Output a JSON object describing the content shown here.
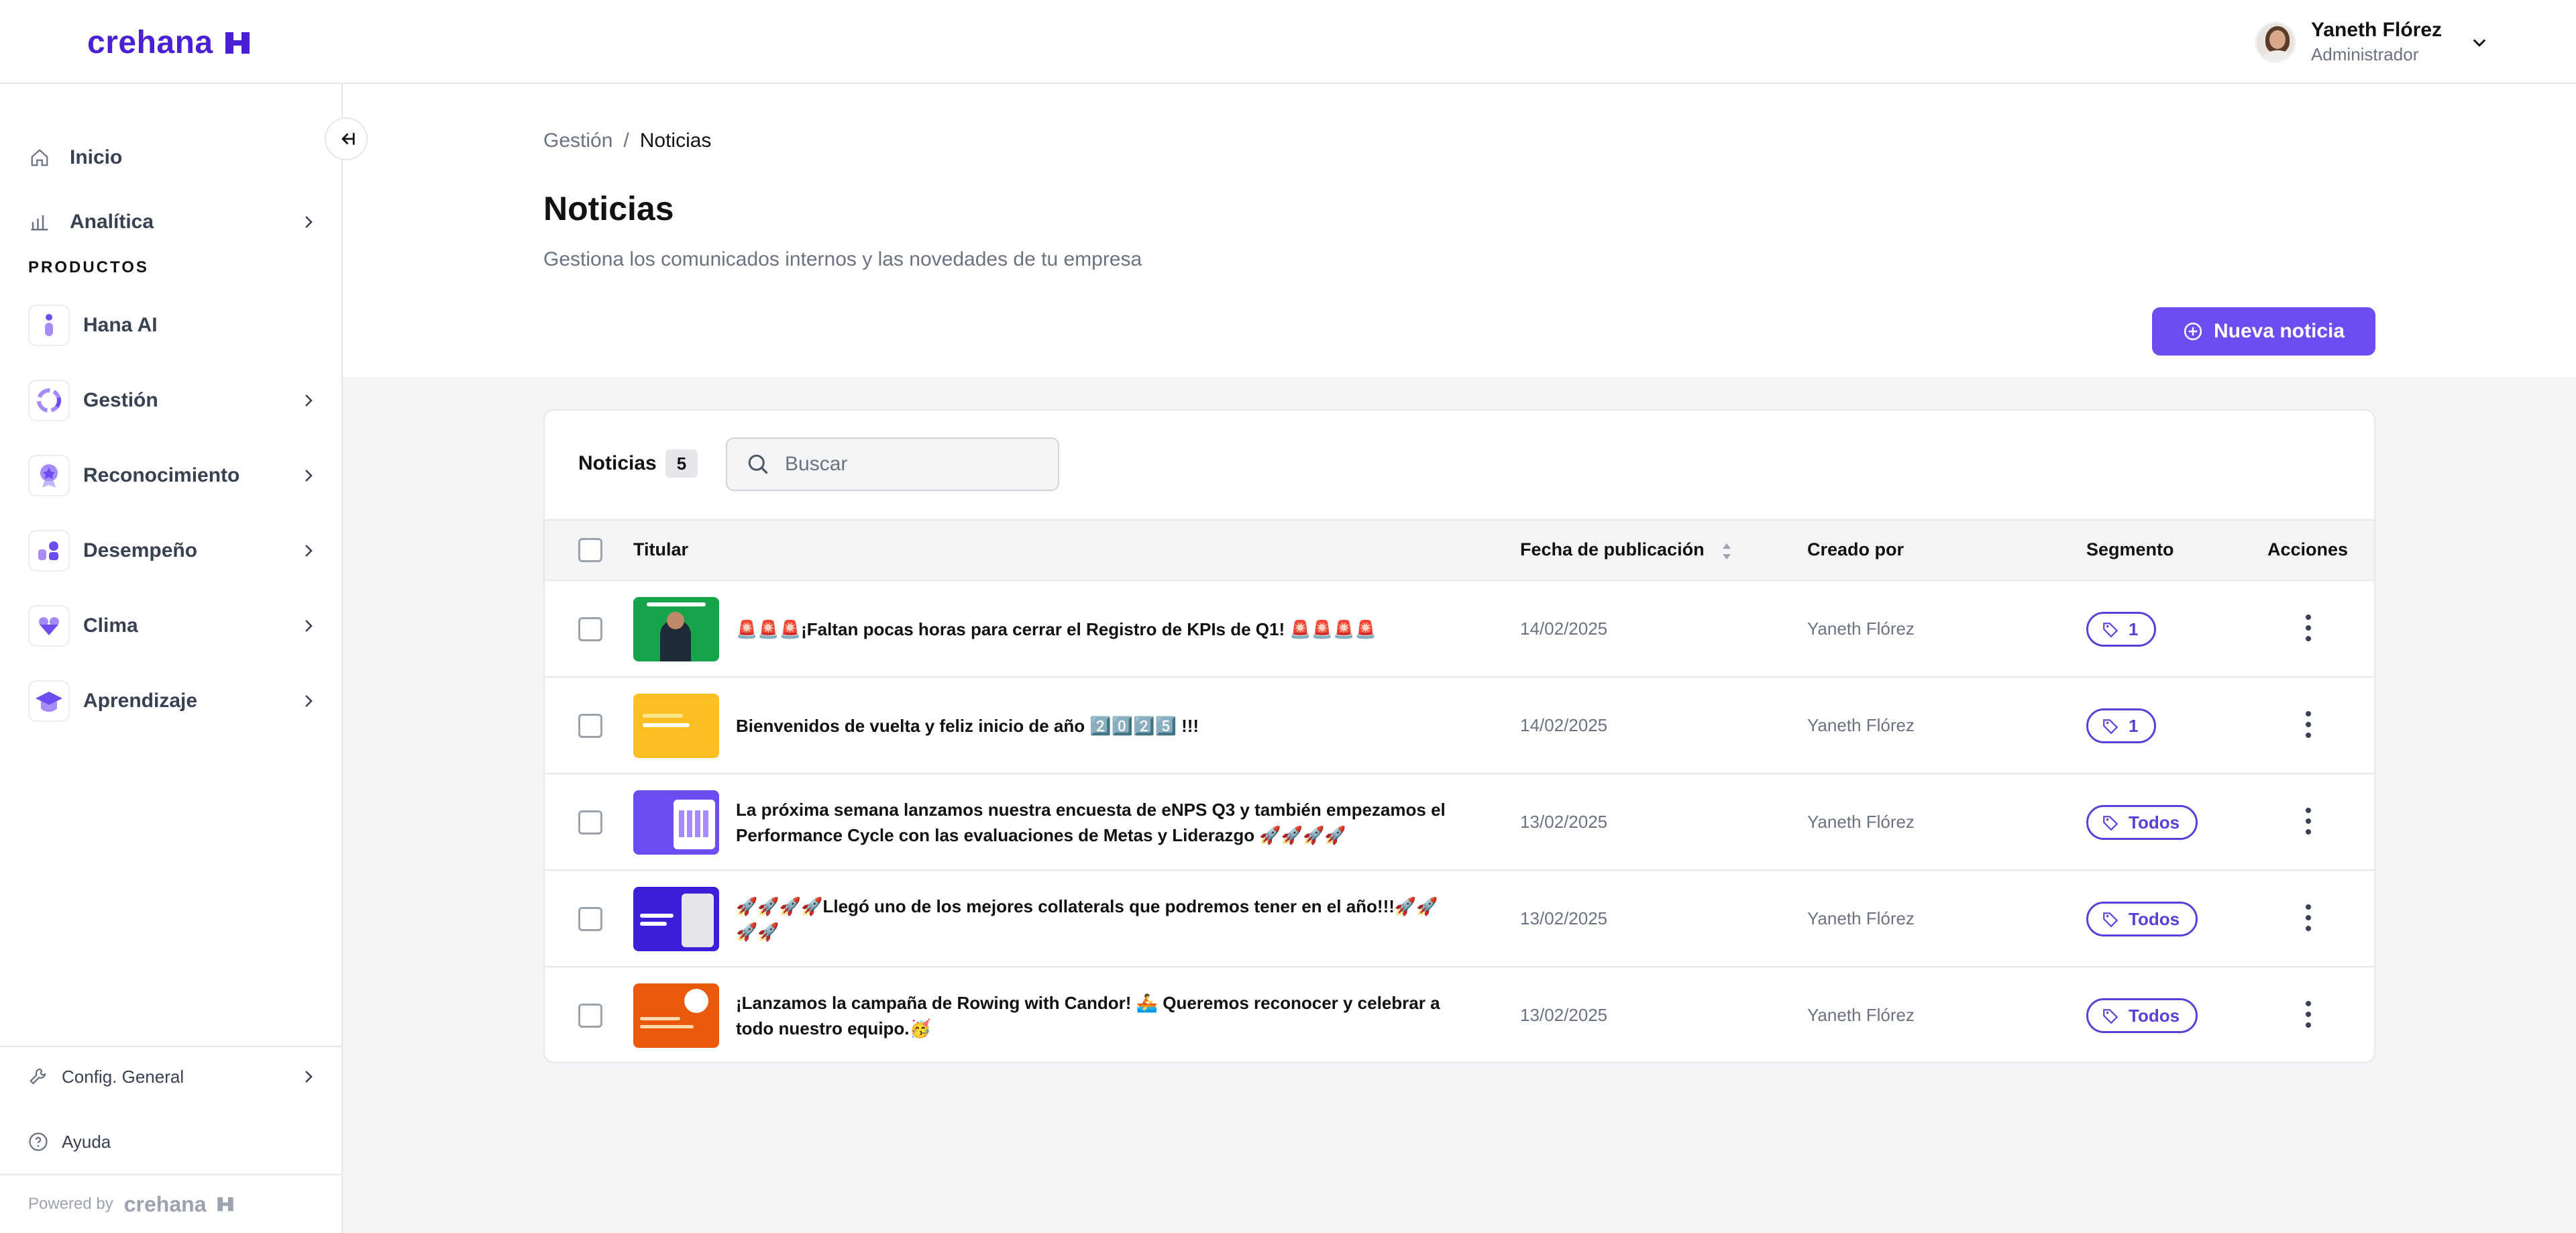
{
  "app": {
    "logo_text": "crehana"
  },
  "user": {
    "name": "Yaneth Flórez",
    "role": "Administrador"
  },
  "sidebar": {
    "top_items": [
      {
        "label": "Inicio",
        "icon": "home-icon"
      },
      {
        "label": "Analítica",
        "icon": "bar-chart-icon"
      }
    ],
    "section_label": "PRODUCTOS",
    "products": [
      {
        "label": "Hana AI",
        "icon": "hana-ai-icon"
      },
      {
        "label": "Gestión",
        "icon": "gestion-icon"
      },
      {
        "label": "Reconocimiento",
        "icon": "reconocimiento-icon"
      },
      {
        "label": "Desempeño",
        "icon": "desempeno-icon"
      },
      {
        "label": "Clima",
        "icon": "clima-icon"
      },
      {
        "label": "Aprendizaje",
        "icon": "aprendizaje-icon"
      }
    ],
    "bottom_items": [
      {
        "label": "Config. General",
        "icon": "wrench-icon"
      },
      {
        "label": "Ayuda",
        "icon": "help-icon"
      }
    ],
    "powered_by_label": "Powered by",
    "powered_by_logo": "crehana"
  },
  "breadcrumb": {
    "parent": "Gestión",
    "separator": "/",
    "current": "Noticias"
  },
  "page": {
    "title": "Noticias",
    "subtitle": "Gestiona los comunicados internos y las novedades de tu empresa",
    "new_button_label": "Nueva noticia"
  },
  "table": {
    "title": "Noticias",
    "count": "5",
    "search_placeholder": "Buscar",
    "columns": {
      "title": "Titular",
      "date": "Fecha de publicación",
      "author": "Creado por",
      "segment": "Segmento",
      "actions": "Acciones"
    },
    "rows": [
      {
        "title": "🚨🚨🚨¡Faltan pocas horas para cerrar el Registro de KPIs de Q1! 🚨🚨🚨🚨",
        "date": "14/02/2025",
        "author": "Yaneth Flórez",
        "segment": "1",
        "thumb_color": "#16a34a"
      },
      {
        "title": "Bienvenidos de vuelta y feliz inicio de año 2️⃣0️⃣2️⃣5️⃣ !!!",
        "date": "14/02/2025",
        "author": "Yaneth Flórez",
        "segment": "1",
        "thumb_color": "#fbbf24"
      },
      {
        "title": "La próxima semana lanzamos nuestra encuesta de eNPS Q3 y también empezamos el Performance Cycle con las evaluaciones de Metas y Liderazgo 🚀🚀🚀🚀",
        "date": "13/02/2025",
        "author": "Yaneth Flórez",
        "segment": "Todos",
        "thumb_color": "#6d4df2"
      },
      {
        "title": "🚀🚀🚀🚀Llegó uno de los mejores collaterals que podremos tener en el año!!!🚀🚀🚀🚀",
        "date": "13/02/2025",
        "author": "Yaneth Flórez",
        "segment": "Todos",
        "thumb_color": "#3b1fd9"
      },
      {
        "title": "¡Lanzamos la campaña de Rowing with Candor! 🚣 Queremos reconocer y celebrar a todo nuestro equipo.🥳",
        "date": "13/02/2025",
        "author": "Yaneth Flórez",
        "segment": "Todos",
        "thumb_color": "#ea580c"
      }
    ]
  },
  "colors": {
    "brand": "#4a1fd6",
    "accent": "#6d4df2",
    "badge_border": "#5b3fd9"
  }
}
